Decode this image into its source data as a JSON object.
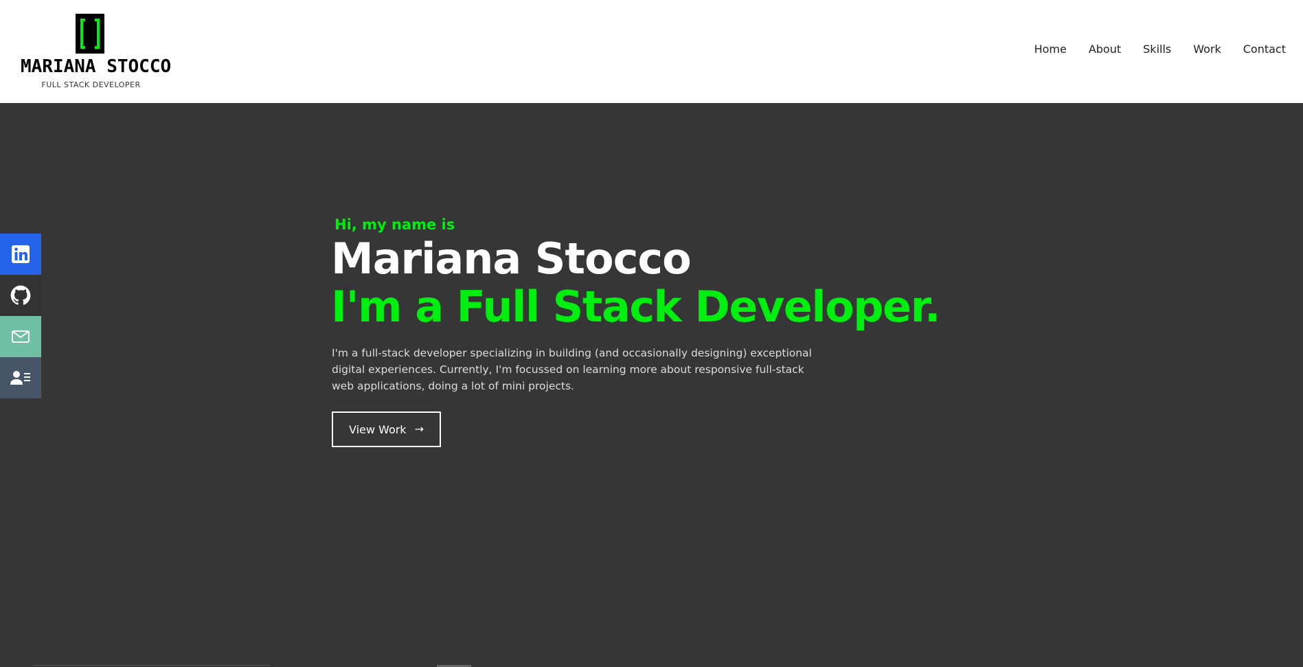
{
  "brand": {
    "name": "MARIANA STOCCO",
    "tagline": "FULL STACK DEVELOPER",
    "accent": "#00ee10"
  },
  "nav": {
    "items": [
      {
        "label": "Home"
      },
      {
        "label": "About"
      },
      {
        "label": "Skills"
      },
      {
        "label": "Work"
      },
      {
        "label": "Contact"
      }
    ]
  },
  "hero": {
    "intro": "Hi, my name is",
    "name": "Mariana Stocco",
    "role": "I'm a Full Stack Developer.",
    "description": "I'm a full-stack developer specializing in building (and occasionally designing) exceptional digital experiences. Currently, I'm focussed on learning more about responsive full-stack web applications, doing a lot of mini projects.",
    "cta_label": "View Work",
    "background": "#363636"
  },
  "social": {
    "items": [
      {
        "icon": "linkedin-icon",
        "color": "#2563eb"
      },
      {
        "icon": "github-icon",
        "color": "#333333"
      },
      {
        "icon": "mail-icon",
        "color": "#6fbfa5"
      },
      {
        "icon": "resume-icon",
        "color": "#475569"
      }
    ]
  }
}
